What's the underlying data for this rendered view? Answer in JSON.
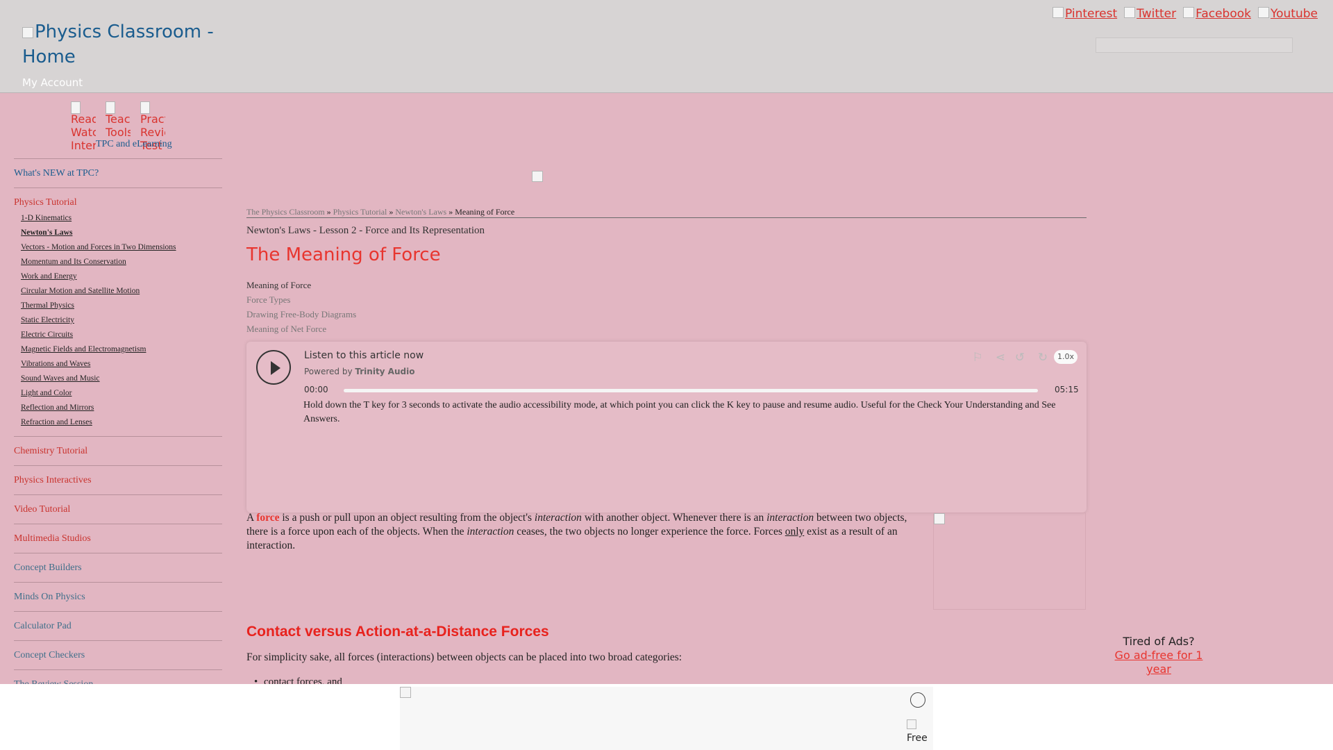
{
  "header": {
    "logo_alt": "Physics Classroom - Home",
    "my_account": "My Account",
    "social": [
      "Pinterest",
      "Twitter",
      "Facebook",
      "Youtube"
    ]
  },
  "sidebar": {
    "icons": [
      "Read Watch Interact",
      "Teacher Tools",
      "Practice Review Test"
    ],
    "tpc_label": "TPC and eLearning",
    "whats_new": "What's NEW at TPC?",
    "physics_tutorial": "Physics Tutorial",
    "tutorial_items": [
      "1-D Kinematics",
      "Newton's Laws",
      "Vectors - Motion and Forces in Two Dimensions",
      "Momentum and Its Conservation",
      "Work and Energy",
      "Circular Motion and Satellite Motion",
      "Thermal Physics",
      "Static Electricity",
      "Electric Circuits",
      "Magnetic Fields and Electromagnetism",
      "Vibrations and Waves",
      "Sound Waves and Music",
      "Light and Color",
      "Reflection and Mirrors",
      "Refraction and Lenses"
    ],
    "sections": [
      "Chemistry Tutorial",
      "Physics Interactives",
      "Video Tutorial",
      "Multimedia Studios",
      "Concept Builders",
      "Minds On Physics",
      "Calculator Pad",
      "Concept Checkers",
      "The Review Session"
    ]
  },
  "breadcrumb": {
    "items": [
      "The Physics Classroom",
      "Physics Tutorial",
      "Newton's Laws"
    ],
    "sep": "»",
    "current": "Meaning of Force"
  },
  "lesson": "Newton's Laws - Lesson 2 - Force and Its Representation",
  "title": "The Meaning of Force",
  "toc": [
    "Meaning of Force",
    "Force Types",
    "Drawing Free-Body Diagrams",
    "Meaning of Net Force"
  ],
  "player": {
    "listen": "Listen to this article now",
    "powered_by": "Powered by",
    "provider": "Trinity Audio",
    "speed": "1.0x",
    "current_time": "00:00",
    "duration": "05:15",
    "progress": 0.0,
    "accessibility_text": "Hold down the T key for 3 seconds to activate the audio accessibility mode, at which point you can click the K key to pause and resume audio. Useful for the Check Your Understanding and See Answers."
  },
  "content": {
    "p1_a": "A ",
    "p1_force": "force",
    "p1_b": " is a push or pull upon an object resulting from the object's ",
    "p1_interaction": "interaction",
    "p1_c": " with another object. Whenever there is an ",
    "p1_d": " between two objects, there is a force upon each of the objects. When the ",
    "p1_e": " ceases, the two objects no longer experience the force. Forces ",
    "p1_only": "only",
    "p1_f": " exist as a result of an interaction.",
    "h2": "Contact versus Action-at-a-Distance Forces",
    "p2": "For simplicity sake, all forces (interactions) between objects can be placed into two broad categories:",
    "bullet1": "contact forces, and"
  },
  "ad": {
    "tired": "Tired of Ads?",
    "go_ad_free": "Go ad-free for 1 year",
    "free_label": "Free"
  }
}
